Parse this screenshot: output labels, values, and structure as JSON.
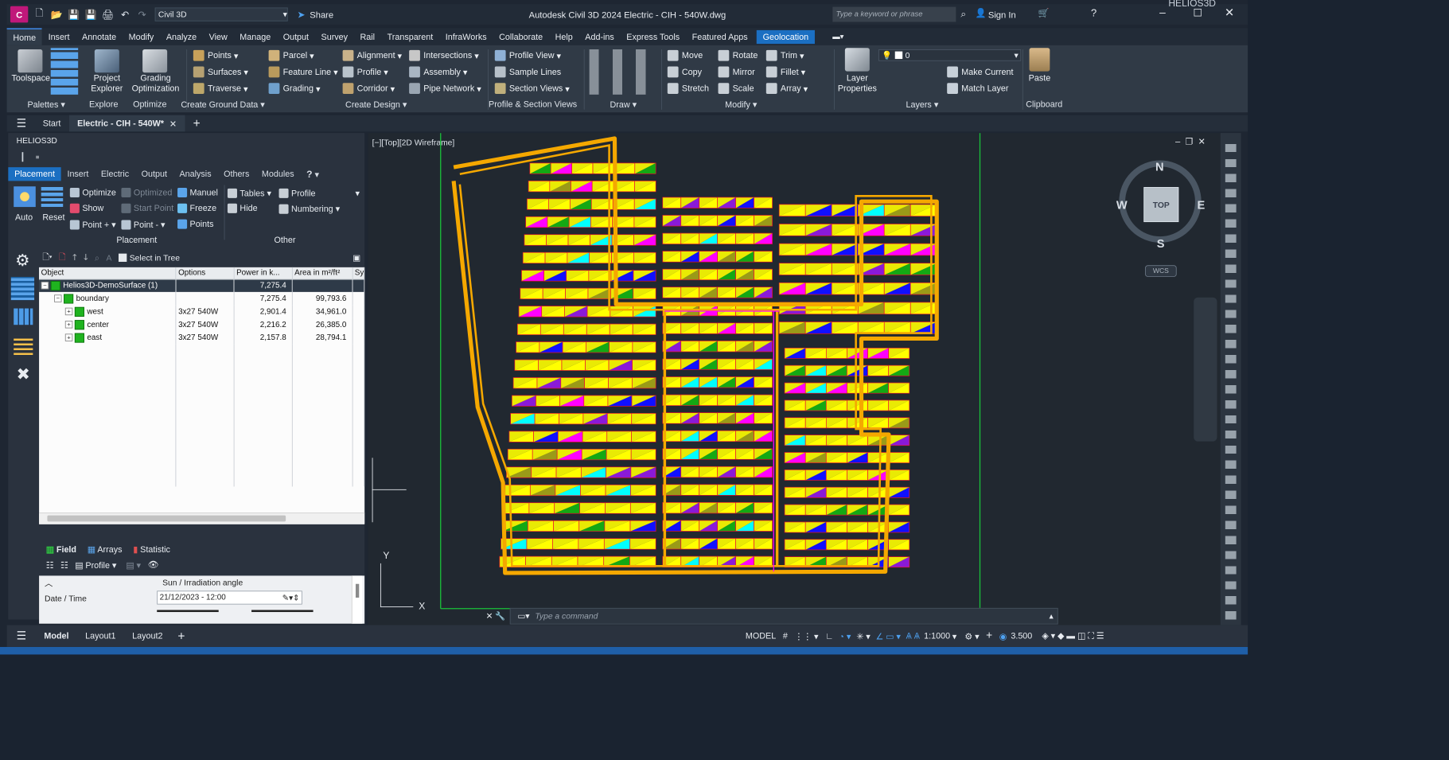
{
  "app": {
    "workspace": "Civil 3D",
    "share_label": "Share",
    "document_title": "Autodesk Civil 3D 2024   Electric - CIH - 540W.dwg",
    "search_placeholder": "Type a keyword or phrase",
    "signin_label": "Sign In",
    "corner_text": "HELIOS3D"
  },
  "menu": [
    "Home",
    "Insert",
    "Annotate",
    "Modify",
    "Analyze",
    "View",
    "Manage",
    "Output",
    "Survey",
    "Rail",
    "Transparent",
    "InfraWorks",
    "Collaborate",
    "Help",
    "Add-ins",
    "Express Tools",
    "Featured Apps",
    "Geolocation"
  ],
  "ribbon": {
    "toolspace": "Toolspace",
    "project_explorer": "Project\nExplorer",
    "grading_optimization": "Grading\nOptimization",
    "points": "Points",
    "surfaces": "Surfaces",
    "traverse": "Traverse",
    "parcel": "Parcel",
    "feature_line": "Feature Line",
    "grading": "Grading",
    "alignment": "Alignment",
    "profile": "Profile",
    "corridor": "Corridor",
    "intersections": "Intersections",
    "assembly": "Assembly",
    "pipe_network": "Pipe Network",
    "profile_view": "Profile View",
    "sample_lines": "Sample Lines",
    "section_views": "Section Views",
    "move": "Move",
    "copy": "Copy",
    "stretch": "Stretch",
    "rotate": "Rotate",
    "mirror": "Mirror",
    "scale": "Scale",
    "trim": "Trim",
    "fillet": "Fillet",
    "array": "Array",
    "layer_properties": "Layer\nProperties",
    "layer_value": "0",
    "make_current": "Make Current",
    "match_layer": "Match Layer",
    "paste": "Paste",
    "groups": [
      "Palettes",
      "Explore",
      "Optimize",
      "Create Ground Data",
      "Create Design",
      "Profile & Section Views",
      "Draw",
      "Modify",
      "Layers",
      "Clipboard"
    ]
  },
  "file_tabs": {
    "start": "Start",
    "active": "Electric - CIH - 540W*"
  },
  "panel": {
    "title": "HELIOS3D",
    "tabs": [
      "Placement",
      "Insert",
      "Electric",
      "Output",
      "Analysis",
      "Others",
      "Modules",
      "?"
    ],
    "auto": "Auto",
    "reset": "Reset",
    "optimize": "Optimize",
    "optimized": "Optimized",
    "manuel": "Manuel",
    "show": "Show",
    "start_point": "Start Point",
    "freeze": "Freeze",
    "point_plus": "Point +",
    "point_minus": "Point -",
    "points": "Points",
    "tables": "Tables",
    "profile": "Profile",
    "hide": "Hide",
    "numbering": "Numbering",
    "group_placement": "Placement",
    "group_other": "Other",
    "select_in_tree": "Select in Tree",
    "columns": [
      "Object",
      "Options",
      "Power in k...",
      "Area in m²/ft²",
      "Sy"
    ],
    "rows": [
      {
        "name": "Helios3D-DemoSurface (1)",
        "options": "",
        "power": "7,275.4",
        "area": ""
      },
      {
        "name": "boundary",
        "options": "",
        "power": "7,275.4",
        "area": "99,793.6"
      },
      {
        "name": "west",
        "options": "3x27 540W",
        "power": "2,901.4",
        "area": "34,961.0"
      },
      {
        "name": "center",
        "options": "3x27 540W",
        "power": "2,216.2",
        "area": "26,385.0"
      },
      {
        "name": "east",
        "options": "3x27 540W",
        "power": "2,157.8",
        "area": "28,794.1"
      }
    ],
    "bottom_tabs": [
      "Field",
      "Arrays",
      "Statistic"
    ],
    "profile_label": "Profile",
    "sun_section": "Sun / Irradiation angle",
    "date_label": "Date / Time",
    "date_value": "21/12/2023 - 12:00"
  },
  "canvas": {
    "view_label": "[−][Top][2D Wireframe]",
    "compass": {
      "n": "N",
      "s": "S",
      "e": "E",
      "w": "W",
      "top": "TOP",
      "wcs": "WCS"
    },
    "command_placeholder": "Type  a  command",
    "colors": {
      "boundary": "#f5a800",
      "panel": "#ffff00",
      "grid": "#e8132a",
      "magenta": "#ff00ff",
      "cyan": "#00ffff",
      "blue": "#1010ff",
      "green": "#14a814",
      "purple": "#8a1ad8",
      "olive": "#9a9a18"
    }
  },
  "statusbar": {
    "tabs": [
      "Model",
      "Layout1",
      "Layout2"
    ],
    "model": "MODEL",
    "scale": "1:1000",
    "annotation": "3.500"
  }
}
